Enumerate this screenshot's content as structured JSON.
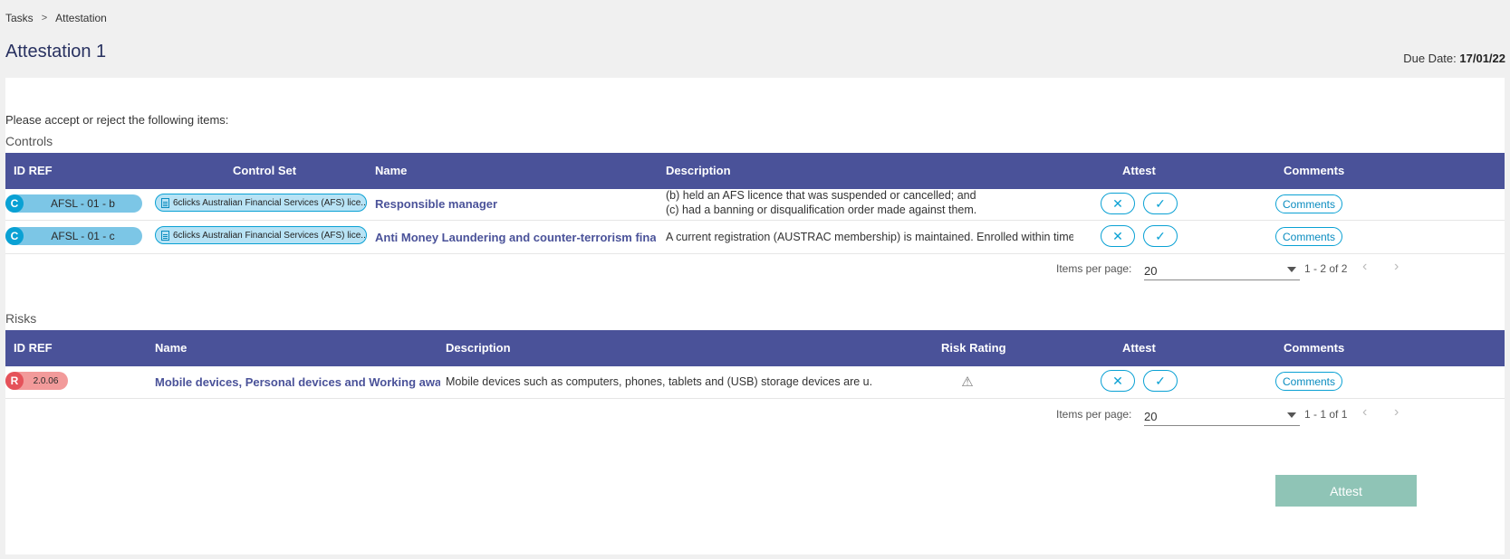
{
  "breadcrumb": {
    "items": [
      "Tasks",
      "Attestation"
    ],
    "separator": ">"
  },
  "page": {
    "title": "Attestation 1",
    "due_label": "Due Date:",
    "due_value": "17/01/22"
  },
  "instructions": "Please accept or reject the following items:",
  "controls": {
    "title": "Controls",
    "headers": {
      "id": "ID REF",
      "control_set": "Control Set",
      "name": "Name",
      "description": "Description",
      "attest": "Attest",
      "comments": "Comments"
    },
    "rows": [
      {
        "letter": "C",
        "id": "AFSL - 01 - b",
        "control_set": "6clicks Australian Financial Services (AFS) lice...",
        "name": "Responsible manager",
        "desc_line1": "(b) held an AFS licence that was suspended or cancelled; and",
        "desc_line2": "(c) had a banning or disqualification order made against them.",
        "reject": "✕",
        "accept": "✓",
        "comments": "Comments"
      },
      {
        "letter": "C",
        "id": "AFSL - 01 - c",
        "control_set": "6clicks Australian Financial Services (AFS) lice...",
        "name": "Anti Money Laundering and counter-terrorism financin...",
        "description": "A current registration (AUSTRAC membership) is maintained. Enrolled within time re",
        "reject": "✕",
        "accept": "✓",
        "comments": "Comments"
      }
    ],
    "pager": {
      "label": "Items per page:",
      "value": "20",
      "range": "1 - 2 of 2",
      "prev": "‹",
      "next": "›"
    }
  },
  "risks": {
    "title": "Risks",
    "headers": {
      "id": "ID REF",
      "name": "Name",
      "description": "Description",
      "rating": "Risk Rating",
      "attest": "Attest",
      "comments": "Comments"
    },
    "rows": [
      {
        "letter": "R",
        "id": "2.0.06",
        "name": "Mobile devices, Personal devices and Working away fro...",
        "description": "Mobile devices such as computers, phones, tablets and (USB) storage devices are u...",
        "rating_icon": "⚠",
        "reject": "✕",
        "accept": "✓",
        "comments": "Comments"
      }
    ],
    "pager": {
      "label": "Items per page:",
      "value": "20",
      "range": "1 - 1 of 1",
      "prev": "‹",
      "next": "›"
    }
  },
  "attest_button": "Attest",
  "colors": {
    "header": "#4a5299",
    "accent": "#0aa1d4",
    "attest_button": "#8fc4b6",
    "risk": "#e5525a"
  }
}
